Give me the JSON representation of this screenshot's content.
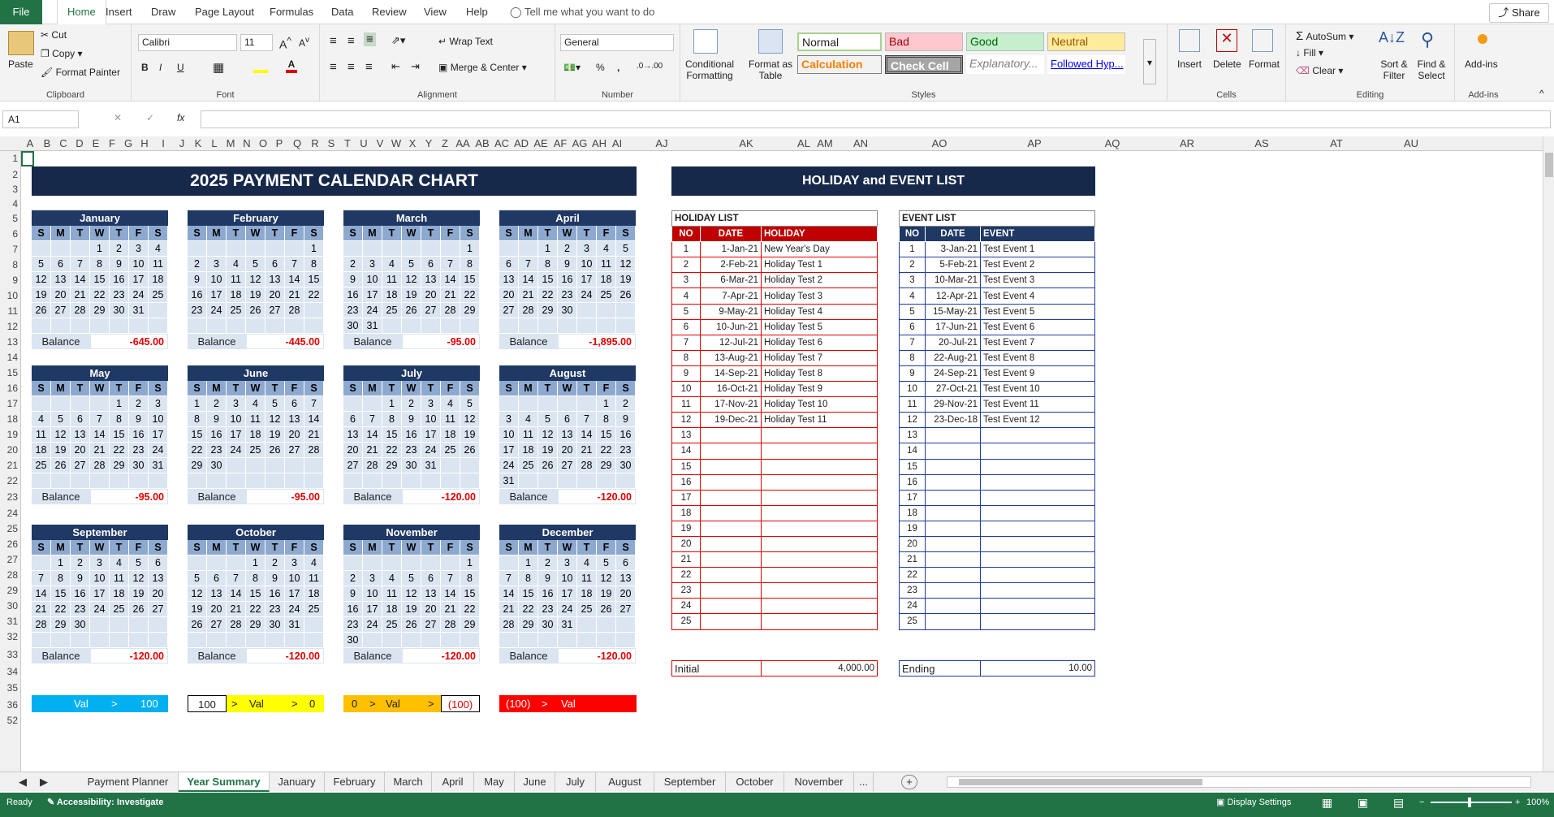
{
  "ribbon_tabs": [
    "File",
    "Home",
    "Insert",
    "Draw",
    "Page Layout",
    "Formulas",
    "Data",
    "Review",
    "View",
    "Help"
  ],
  "tell_me": "Tell me what you want to do",
  "share": "Share",
  "clipboard": {
    "paste": "Paste",
    "cut": "Cut",
    "copy": "Copy",
    "format_painter": "Format Painter",
    "label": "Clipboard"
  },
  "font": {
    "name": "Calibri",
    "size": "11",
    "label": "Font"
  },
  "alignment": {
    "wrap": "Wrap Text",
    "merge": "Merge & Center",
    "label": "Alignment"
  },
  "number": {
    "format": "General",
    "label": "Number"
  },
  "styles": {
    "cond": "Conditional Formatting",
    "fmt_table": "Format as Table",
    "normal": "Normal",
    "bad": "Bad",
    "good": "Good",
    "neutral": "Neutral",
    "calc": "Calculation",
    "check": "Check Cell",
    "explan": "Explanatory...",
    "followed": "Followed Hyp...",
    "label": "Styles"
  },
  "cells": {
    "insert": "Insert",
    "delete": "Delete",
    "format": "Format",
    "label": "Cells"
  },
  "editing": {
    "autosum": "AutoSum",
    "fill": "Fill",
    "clear": "Clear",
    "sort": "Sort & Filter",
    "find": "Find & Select",
    "label": "Editing"
  },
  "addins": {
    "addins": "Add-ins",
    "label": "Add-ins"
  },
  "namebox": "A1",
  "columns": [
    "A",
    "B",
    "C",
    "D",
    "E",
    "F",
    "G",
    "H",
    "I",
    "J",
    "K",
    "L",
    "M",
    "N",
    "O",
    "P",
    "Q",
    "R",
    "S",
    "T",
    "U",
    "V",
    "W",
    "X",
    "Y",
    "Z",
    "AA",
    "AB",
    "AC",
    "AD",
    "AE",
    "AF",
    "AG",
    "AH",
    "AI",
    "AJ",
    "AK",
    "AL",
    "AM",
    "AN",
    "AO",
    "AP",
    "AQ",
    "AR",
    "AS",
    "AT",
    "AU"
  ],
  "rows": [
    "1",
    "2",
    "3",
    "4",
    "5",
    "6",
    "7",
    "8",
    "9",
    "10",
    "11",
    "12",
    "13",
    "14",
    "15",
    "16",
    "17",
    "18",
    "19",
    "20",
    "21",
    "22",
    "23",
    "24",
    "25",
    "26",
    "27",
    "28",
    "29",
    "30",
    "31",
    "32",
    "33",
    "34",
    "35",
    "36",
    "52"
  ],
  "calendar_title": "2025 PAYMENT CALENDAR CHART",
  "holiday_title": "HOLIDAY and EVENT LIST",
  "weekdays": [
    "S",
    "M",
    "T",
    "W",
    "T",
    "F",
    "S"
  ],
  "balance_label": "Balance",
  "months": [
    {
      "name": "January",
      "offset": 3,
      "days": 31,
      "balance": "-645.00"
    },
    {
      "name": "February",
      "offset": 6,
      "days": 28,
      "balance": "-445.00"
    },
    {
      "name": "March",
      "offset": 6,
      "days": 31,
      "balance": "-95.00"
    },
    {
      "name": "April",
      "offset": 2,
      "days": 30,
      "balance": "-1,895.00"
    },
    {
      "name": "May",
      "offset": 4,
      "days": 31,
      "balance": "-95.00"
    },
    {
      "name": "June",
      "offset": 0,
      "days": 30,
      "balance": "-95.00"
    },
    {
      "name": "July",
      "offset": 2,
      "days": 31,
      "balance": "-120.00"
    },
    {
      "name": "August",
      "offset": 5,
      "days": 31,
      "balance": "-120.00"
    },
    {
      "name": "September",
      "offset": 1,
      "days": 30,
      "balance": "-120.00"
    },
    {
      "name": "October",
      "offset": 3,
      "days": 31,
      "balance": "-120.00"
    },
    {
      "name": "November",
      "offset": 6,
      "days": 30,
      "balance": "-120.00"
    },
    {
      "name": "December",
      "offset": 1,
      "days": 31,
      "balance": "-120.00"
    }
  ],
  "holiday_list": {
    "title": "HOLIDAY LIST",
    "headers": [
      "NO",
      "DATE",
      "HOLIDAY"
    ],
    "rows": [
      [
        "1",
        "1-Jan-21",
        "New Year's Day"
      ],
      [
        "2",
        "2-Feb-21",
        "Holiday Test 1"
      ],
      [
        "3",
        "6-Mar-21",
        "Holiday Test 2"
      ],
      [
        "4",
        "7-Apr-21",
        "Holiday Test 3"
      ],
      [
        "5",
        "9-May-21",
        "Holiday Test 4"
      ],
      [
        "6",
        "10-Jun-21",
        "Holiday Test 5"
      ],
      [
        "7",
        "12-Jul-21",
        "Holiday Test 6"
      ],
      [
        "8",
        "13-Aug-21",
        "Holiday Test 7"
      ],
      [
        "9",
        "14-Sep-21",
        "Holiday Test 8"
      ],
      [
        "10",
        "16-Oct-21",
        "Holiday Test 9"
      ],
      [
        "11",
        "17-Nov-21",
        "Holiday Test 10"
      ],
      [
        "12",
        "19-Dec-21",
        "Holiday Test 11"
      ],
      [
        "13",
        "",
        ""
      ],
      [
        "14",
        "",
        ""
      ],
      [
        "15",
        "",
        ""
      ],
      [
        "16",
        "",
        ""
      ],
      [
        "17",
        "",
        ""
      ],
      [
        "18",
        "",
        ""
      ],
      [
        "19",
        "",
        ""
      ],
      [
        "20",
        "",
        ""
      ],
      [
        "21",
        "",
        ""
      ],
      [
        "22",
        "",
        ""
      ],
      [
        "23",
        "",
        ""
      ],
      [
        "24",
        "",
        ""
      ],
      [
        "25",
        "",
        ""
      ]
    ],
    "initial_label": "Initial",
    "initial_value": "4,000.00"
  },
  "event_list": {
    "title": "EVENT LIST",
    "headers": [
      "NO",
      "DATE",
      "EVENT"
    ],
    "rows": [
      [
        "1",
        "3-Jan-21",
        "Test Event 1"
      ],
      [
        "2",
        "5-Feb-21",
        "Test Event 2"
      ],
      [
        "3",
        "10-Mar-21",
        "Test Event 3"
      ],
      [
        "4",
        "12-Apr-21",
        "Test Event 4"
      ],
      [
        "5",
        "15-May-21",
        "Test Event 5"
      ],
      [
        "6",
        "17-Jun-21",
        "Test Event 6"
      ],
      [
        "7",
        "20-Jul-21",
        "Test Event 7"
      ],
      [
        "8",
        "22-Aug-21",
        "Test Event 8"
      ],
      [
        "9",
        "24-Sep-21",
        "Test Event 9"
      ],
      [
        "10",
        "27-Oct-21",
        "Test Event 10"
      ],
      [
        "11",
        "29-Nov-21",
        "Test Event 11"
      ],
      [
        "12",
        "23-Dec-18",
        "Test Event 12"
      ],
      [
        "13",
        "",
        ""
      ],
      [
        "14",
        "",
        ""
      ],
      [
        "15",
        "",
        ""
      ],
      [
        "16",
        "",
        ""
      ],
      [
        "17",
        "",
        ""
      ],
      [
        "18",
        "",
        ""
      ],
      [
        "19",
        "",
        ""
      ],
      [
        "20",
        "",
        ""
      ],
      [
        "21",
        "",
        ""
      ],
      [
        "22",
        "",
        ""
      ],
      [
        "23",
        "",
        ""
      ],
      [
        "24",
        "",
        ""
      ],
      [
        "25",
        "",
        ""
      ]
    ],
    "ending_label": "Ending",
    "ending_value": "10.00"
  },
  "legend": [
    {
      "left": "Val",
      "mid": ">",
      "right": "100",
      "bg": "#00b0f0"
    },
    {
      "left": "100",
      "mid": ">",
      "right": "Val",
      "end": ">",
      "endv": "0",
      "bg": "#ffff00"
    },
    {
      "left": "0",
      "mid": ">",
      "right": "Val",
      "end": ">",
      "endv": "(100)",
      "bg": "#ffc000"
    },
    {
      "left": "(100)",
      "mid": ">",
      "right": "Val",
      "bg": "#ff0000"
    }
  ],
  "sheet_tabs": [
    "Payment Planner",
    "Year Summary",
    "January",
    "February",
    "March",
    "April",
    "May",
    "June",
    "July",
    "August",
    "September",
    "October",
    "November",
    "..."
  ],
  "active_sheet": "Year Summary",
  "status": {
    "ready": "Ready",
    "accessibility": "Accessibility: Investigate",
    "display": "Display Settings",
    "zoom": "100%"
  },
  "colors": {
    "excel_green": "#217346",
    "title_navy": "#17294a",
    "month_header": "#1f3864",
    "day_cell": "#dbe5f1",
    "weekday_cell": "#8ea9cf",
    "holiday_header": "#c00000",
    "event_header": "#1f3864",
    "balance_red": "#e00000"
  }
}
